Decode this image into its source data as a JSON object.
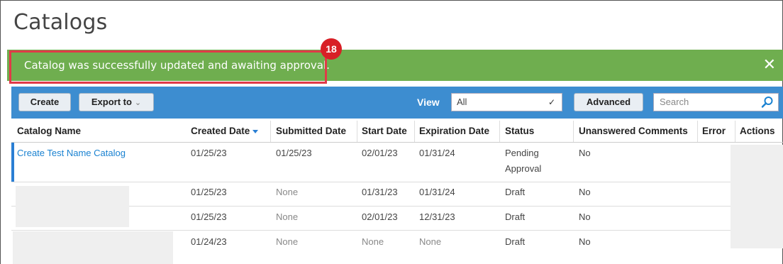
{
  "page": {
    "title": "Catalogs"
  },
  "alert": {
    "message": "Catalog was successfully updated and awaiting approval.",
    "close_glyph": "✕",
    "color": "#6fae4f"
  },
  "callout": {
    "step": "18",
    "color": "#d81f26"
  },
  "toolbar": {
    "create_label": "Create",
    "export_label": "Export to",
    "view_label": "View",
    "view_value": "All",
    "advanced_label": "Advanced",
    "search_placeholder": "Search",
    "accent": "#3d8dd0"
  },
  "table": {
    "columns": [
      "Catalog Name",
      "Created Date",
      "Submitted Date",
      "Start Date",
      "Expiration Date",
      "Status",
      "Unanswered Comments",
      "Error",
      "Actions"
    ],
    "rows": [
      {
        "name": "Create Test Name Catalog",
        "created": "01/25/23",
        "submitted": "01/25/23",
        "start": "02/01/23",
        "expiration": "01/31/24",
        "status": "Pending",
        "status2": "Approval",
        "comments": "No"
      },
      {
        "name": "",
        "created": "01/25/23",
        "submitted": "None",
        "start": "01/31/23",
        "expiration": "01/31/24",
        "status": "Draft",
        "comments": "No"
      },
      {
        "name": "",
        "created": "01/25/23",
        "submitted": "None",
        "start": "02/01/23",
        "expiration": "12/31/23",
        "status": "Draft",
        "comments": "No"
      },
      {
        "name": "",
        "created": "01/24/23",
        "submitted": "None",
        "start": "None",
        "expiration": "None",
        "status": "Draft",
        "comments": "No"
      }
    ]
  }
}
